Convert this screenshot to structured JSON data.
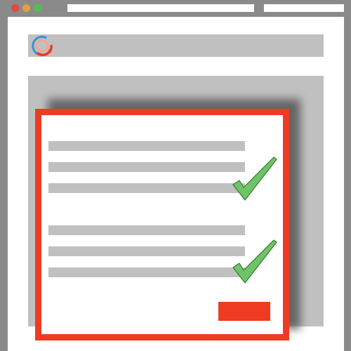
{
  "window": {
    "controls": [
      "close",
      "minimize",
      "maximize"
    ],
    "address_bar": "",
    "search_bar": ""
  },
  "header": {
    "logo_icon": "circular-arrows-logo-icon"
  },
  "modal": {
    "sections": [
      {
        "lines": 3,
        "status_icon": "check-icon"
      },
      {
        "lines": 3,
        "status_icon": "check-icon"
      }
    ],
    "submit_label": ""
  },
  "colors": {
    "chrome": "#8a8a8a",
    "placeholder": "#c0c0c0",
    "accent": "#ee3b22",
    "check": "#6fc46a",
    "logo_blue": "#3b8fd8"
  }
}
